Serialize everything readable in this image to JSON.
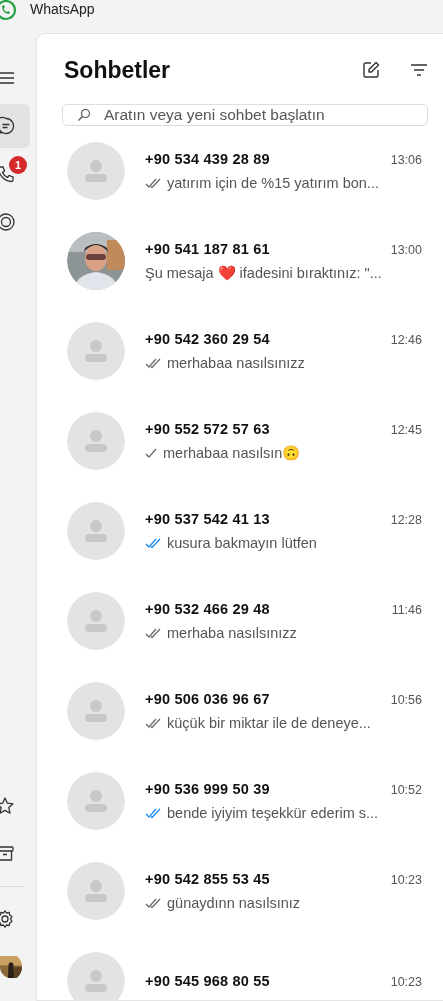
{
  "window": {
    "title": "WhatsApp"
  },
  "nav": [
    {
      "kind": "menu",
      "selected": false
    },
    {
      "kind": "chats",
      "selected": true
    },
    {
      "kind": "calls",
      "selected": false,
      "badge": "1"
    },
    {
      "kind": "status",
      "selected": false
    }
  ],
  "nav_bottom": [
    {
      "kind": "starred"
    },
    {
      "kind": "archive"
    },
    {
      "kind": "settings"
    },
    {
      "kind": "profile"
    }
  ],
  "header": {
    "title": "Sohbetler"
  },
  "search": {
    "placeholder": "Aratın veya yeni sohbet başlatın"
  },
  "chats": [
    {
      "name": "+90 534 439 28 89",
      "time": "13:06",
      "receipt": {
        "kind": "double",
        "read": false
      },
      "message": "yatırım için de %15 yatırım bon...",
      "avatar": {
        "kind": "default"
      }
    },
    {
      "name": "+90 541 187 81 61",
      "time": "13:00",
      "message": "Şu mesaja ❤️ ifadesini bıraktınız: \"..."
    },
    {
      "name": "+90 542 360 29 54",
      "time": "12:46",
      "receipt": {
        "kind": "double",
        "read": false
      },
      "message": "merhabaa nasılsınızz",
      "avatar": {
        "kind": "default"
      }
    },
    {
      "name": "+90 552 572 57 63",
      "time": "12:45",
      "receipt": {
        "kind": "single"
      },
      "message": "merhabaa nasılsın🙃",
      "avatar": {
        "kind": "default"
      }
    },
    {
      "name": "+90 537 542 41 13",
      "time": "12:28",
      "receipt": {
        "kind": "double",
        "read": true
      },
      "message": "kusura bakmayın lütfen",
      "avatar": {
        "kind": "default"
      }
    },
    {
      "name": "+90 532 466 29 48",
      "time": "11:46",
      "receipt": {
        "kind": "double",
        "read": false
      },
      "message": "merhaba nasılsınızz",
      "avatar": {
        "kind": "default"
      }
    },
    {
      "name": "+90 506 036 96 67",
      "time": "10:56",
      "receipt": {
        "kind": "double",
        "read": false
      },
      "message": "küçük bir miktar ile de deneye...",
      "avatar": {
        "kind": "default"
      }
    },
    {
      "name": "+90 536 999 50 39",
      "time": "10:52",
      "receipt": {
        "kind": "double",
        "read": true
      },
      "message": "bende iyiyim teşekkür ederim s...",
      "avatar": {
        "kind": "default"
      }
    },
    {
      "name": "+90 542 855 53 45",
      "time": "10:23",
      "receipt": {
        "kind": "double",
        "read": false
      },
      "message": "günaydınn nasılsınız",
      "avatar": {
        "kind": "default"
      }
    },
    {
      "name": "+90 545 968 80 55",
      "time": "10:23",
      "avatar": {
        "kind": "default"
      }
    }
  ]
}
